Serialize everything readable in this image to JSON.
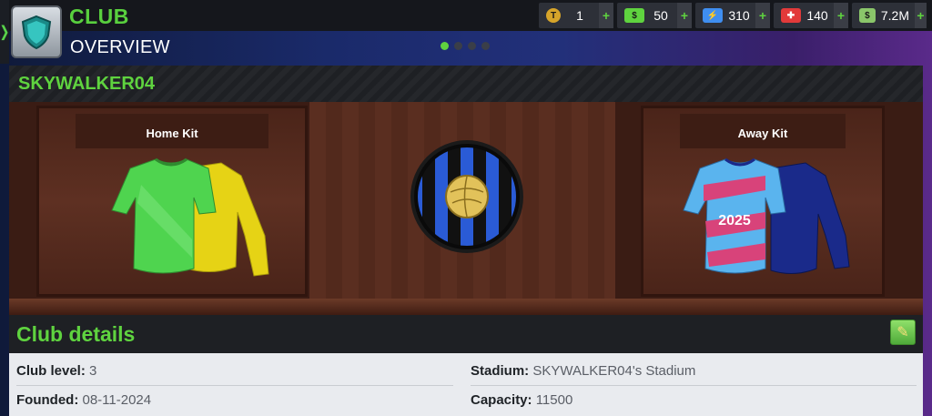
{
  "header": {
    "title": "CLUB",
    "subtitle": "OVERVIEW",
    "back_glyph": "❭"
  },
  "pager": {
    "pages": 4,
    "active": 0
  },
  "currencies": [
    {
      "icon": "token-icon",
      "glyph": "T",
      "color": "#d6a42a",
      "value": "1"
    },
    {
      "icon": "cash-icon",
      "glyph": "$",
      "color": "#5fd33f",
      "value": "50"
    },
    {
      "icon": "energy-icon",
      "glyph": "⚡",
      "color": "#3f8ef0",
      "value": "310"
    },
    {
      "icon": "medical-icon",
      "glyph": "✚",
      "color": "#e23a3a",
      "value": "140"
    },
    {
      "icon": "money-icon",
      "glyph": "$",
      "color": "#8ac66a",
      "value": "7.2M"
    }
  ],
  "plus_glyph": "+",
  "club": {
    "name": "SKYWALKER04"
  },
  "kits": {
    "home_label": "Home Kit",
    "away_label": "Away Kit",
    "away_number": "2025"
  },
  "details": {
    "heading": "Club details",
    "edit_glyph": "✎",
    "level_label": "Club level:",
    "level_value": "3",
    "founded_label": "Founded:",
    "founded_value": "08-11-2024",
    "stadium_label": "Stadium:",
    "stadium_value": "SKYWALKER04's Stadium",
    "capacity_label": "Capacity:",
    "capacity_value": "11500"
  },
  "colors": {
    "accent": "#5fd33f",
    "emblem_blue": "#2a5bd6",
    "emblem_black": "#111111",
    "ball": "#e2c25a"
  }
}
